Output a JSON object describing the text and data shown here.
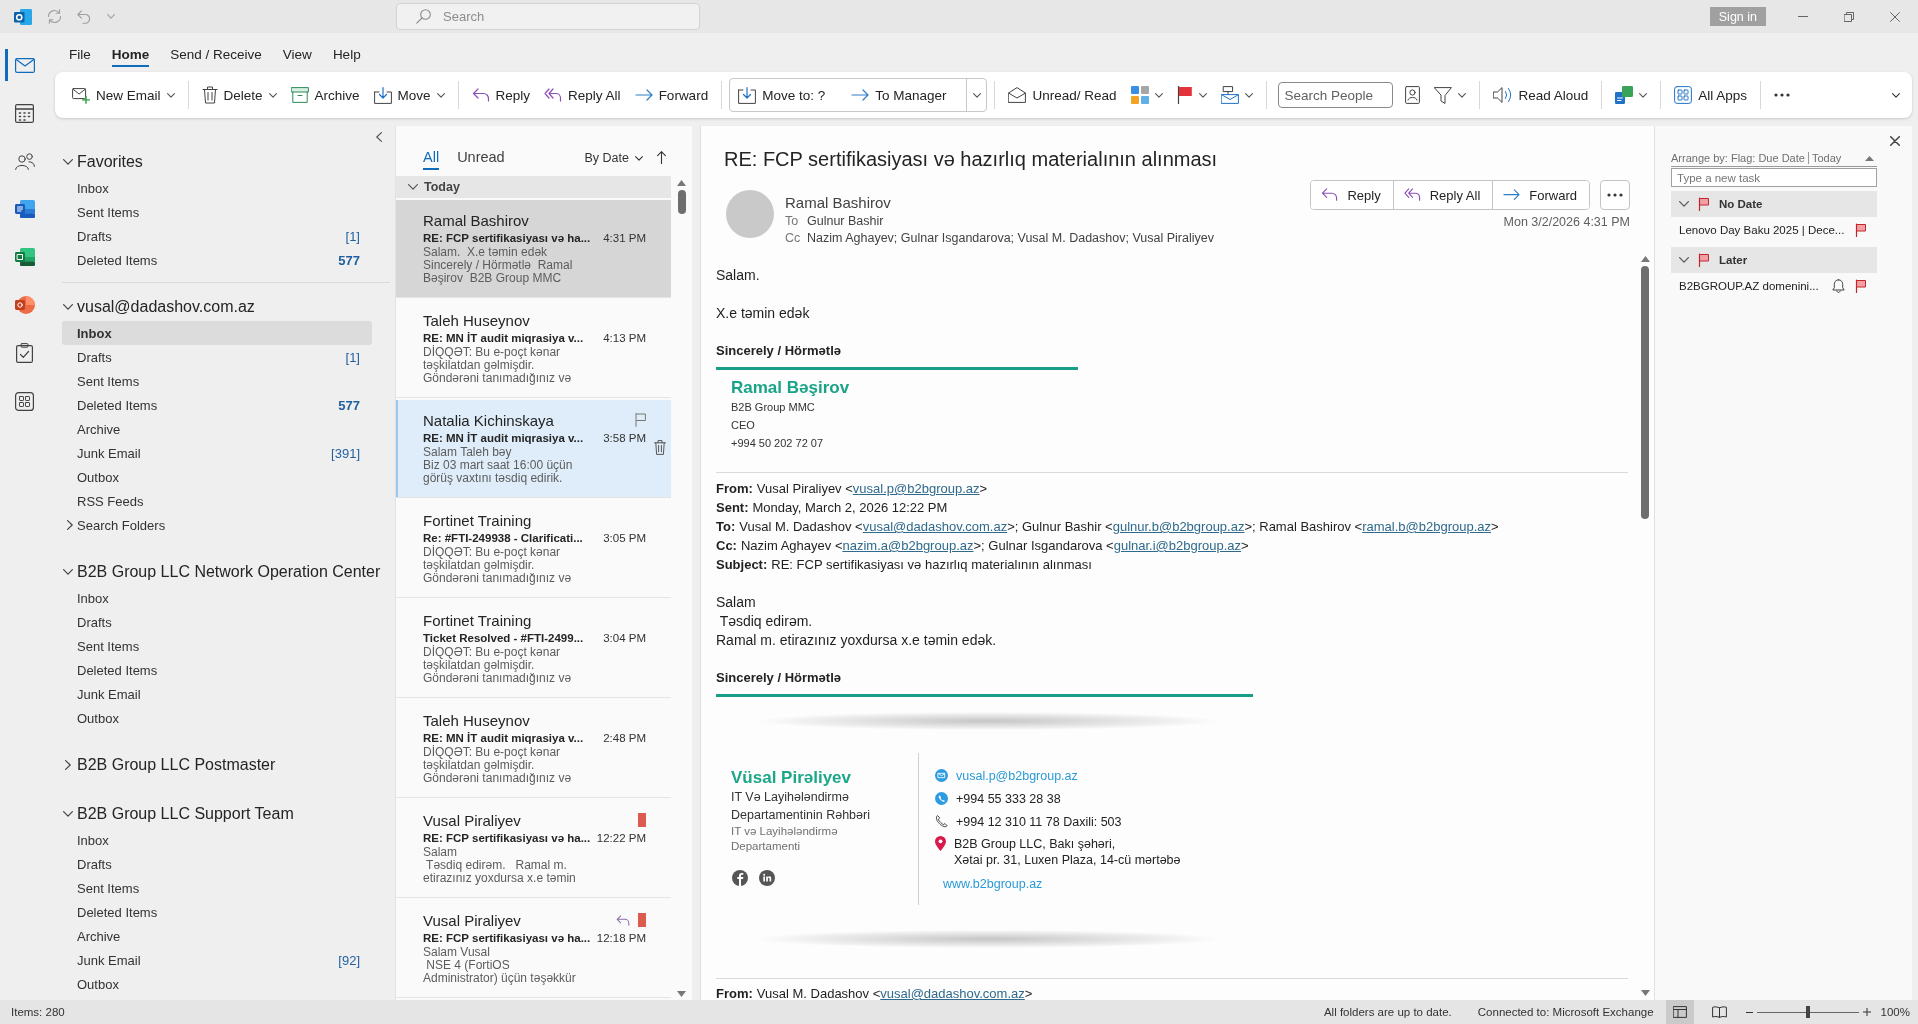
{
  "title_bar": {
    "search_placeholder": "Search",
    "sign_in": "Sign in"
  },
  "app_rail": [
    {
      "selected": true
    },
    {
      "selected": false
    },
    {
      "selected": false
    },
    {
      "selected": false
    },
    {
      "selected": false
    },
    {
      "selected": false
    },
    {
      "selected": false
    },
    {
      "selected": false
    }
  ],
  "menu_tabs": [
    {
      "label": "File",
      "selected": false
    },
    {
      "label": "Home",
      "selected": true
    },
    {
      "label": "Send / Receive",
      "selected": false
    },
    {
      "label": "View",
      "selected": false
    },
    {
      "label": "Help",
      "selected": false
    }
  ],
  "ribbon": [
    {
      "kind": "button",
      "label": "New Email",
      "dropdown": true
    },
    {
      "kind": "separator"
    },
    {
      "kind": "button",
      "label": "Delete",
      "dropdown": true
    },
    {
      "kind": "button",
      "label": "Archive",
      "dropdown": false
    },
    {
      "kind": "button",
      "label": "Move",
      "dropdown": true
    },
    {
      "kind": "separator"
    },
    {
      "kind": "button",
      "label": "Reply",
      "dropdown": false
    },
    {
      "kind": "button",
      "label": "Reply All",
      "dropdown": false
    },
    {
      "kind": "button",
      "label": "Forward",
      "dropdown": false
    },
    {
      "kind": "separator"
    },
    {
      "kind": "quick_steps",
      "steps": [
        "Move to: ?",
        "To Manager"
      ]
    },
    {
      "kind": "separator"
    },
    {
      "kind": "button",
      "label": "Unread/ Read",
      "dropdown": false
    },
    {
      "kind": "button",
      "dropdown": true
    },
    {
      "kind": "button",
      "dropdown": true
    },
    {
      "kind": "button",
      "dropdown": true
    },
    {
      "kind": "separator"
    },
    {
      "kind": "search",
      "placeholder": "Search People"
    },
    {
      "kind": "button",
      "dropdown": false
    },
    {
      "kind": "button",
      "dropdown": true
    },
    {
      "kind": "separator"
    },
    {
      "kind": "button",
      "label": "Read Aloud",
      "dropdown": false
    },
    {
      "kind": "separator"
    },
    {
      "kind": "button",
      "dropdown": true
    },
    {
      "kind": "separator"
    },
    {
      "kind": "button",
      "label": "All Apps",
      "dropdown": false
    },
    {
      "kind": "separator"
    },
    {
      "kind": "more"
    }
  ],
  "folder_pane": {
    "groups": [
      {
        "kind": "favorites",
        "name": "Favorites",
        "expanded": true,
        "folders": [
          {
            "name": "Inbox",
            "selected": false
          },
          {
            "name": "Sent Items",
            "selected": false
          },
          {
            "name": "Drafts",
            "count": "[1]",
            "unread": false,
            "selected": false
          },
          {
            "name": "Deleted Items",
            "count": "577",
            "unread": true,
            "selected": false
          }
        ]
      },
      {
        "kind": "account",
        "name": "vusal@dadashov.com.az",
        "expanded": true,
        "folders": [
          {
            "name": "Inbox",
            "selected": true
          },
          {
            "name": "Drafts",
            "count": "[1]",
            "unread": false,
            "selected": false
          },
          {
            "name": "Sent Items",
            "selected": false
          },
          {
            "name": "Deleted Items",
            "count": "577",
            "unread": true,
            "selected": false
          },
          {
            "name": "Archive",
            "selected": false
          },
          {
            "name": "Junk Email",
            "count": "[391]",
            "unread": false,
            "selected": false
          },
          {
            "name": "Outbox",
            "selected": false
          },
          {
            "name": "RSS Feeds",
            "selected": false
          },
          {
            "name": "Search Folders",
            "expanded": false,
            "selected": false
          }
        ]
      },
      {
        "kind": "account",
        "name": "B2B Group LLC Network Operation Center",
        "expanded": true,
        "folders": [
          {
            "name": "Inbox",
            "selected": false
          },
          {
            "name": "Drafts",
            "selected": false
          },
          {
            "name": "Sent Items",
            "selected": false
          },
          {
            "name": "Deleted Items",
            "selected": false
          },
          {
            "name": "Junk Email",
            "selected": false
          },
          {
            "name": "Outbox",
            "selected": false
          }
        ]
      },
      {
        "kind": "account",
        "name": "B2B Group LLC Postmaster",
        "expanded": false
      },
      {
        "kind": "account",
        "name": "B2B Group LLC Support Team",
        "expanded": true,
        "folders": [
          {
            "name": "Inbox",
            "selected": false
          },
          {
            "name": "Drafts",
            "selected": false
          },
          {
            "name": "Sent Items",
            "selected": false
          },
          {
            "name": "Deleted Items",
            "selected": false
          },
          {
            "name": "Archive",
            "selected": false
          },
          {
            "name": "Junk Email",
            "count": "[92]",
            "unread": false,
            "selected": false
          },
          {
            "name": "Outbox",
            "selected": false
          }
        ]
      }
    ]
  },
  "message_list": {
    "filters": [
      {
        "label": "All",
        "selected": true
      },
      {
        "label": "Unread",
        "selected": false
      }
    ],
    "sort": "By Date",
    "group": {
      "label": "Today",
      "expanded": true
    },
    "messages": [
      {
        "sender": "Ramal Bashirov",
        "subject": "RE: FCP sertifikasiyası və ha...",
        "time": "4:31 PM",
        "preview": [
          "Salam.  X.e təmin edək",
          "Sincerely / Hörmətlə  Ramal",
          "Bəşirov  B2B Group MMC"
        ],
        "selected": true,
        "hovered": false,
        "replied": false
      },
      {
        "sender": "Taleh Huseynov",
        "subject": "RE: MN İT audit miqrasiya v...",
        "time": "4:13 PM",
        "preview": [
          "DİQQƏT: Bu e-poçt kənar",
          "təşkilatdan gəlmişdir.",
          "Göndərəni tanımadığınız və"
        ],
        "selected": false,
        "hovered": false,
        "replied": false
      },
      {
        "sender": "Natalia Kichinskaya",
        "subject": "RE: MN İT audit miqrasiya v...",
        "time": "3:58 PM",
        "preview": [
          "Salam Taleh bəy",
          "Biz 03 mart saat 16:00 üçün",
          "görüş vaxtını təsdiq edirik."
        ],
        "selected": false,
        "hovered": true,
        "replied": false
      },
      {
        "sender": "Fortinet Training",
        "subject": "Re: #FTI-249938 - Clarificati...",
        "time": "3:05 PM",
        "preview": [
          "DİQQƏT: Bu e-poçt kənar",
          "təşkilatdan gəlmişdir.",
          "Göndərəni tanımadığınız və"
        ],
        "selected": false,
        "hovered": false,
        "replied": false
      },
      {
        "sender": "Fortinet Training",
        "subject": "Ticket Resolved - #FTI-2499...",
        "time": "3:04 PM",
        "preview": [
          "DİQQƏT: Bu e-poçt kənar",
          "təşkilatdan gəlmişdir.",
          "Göndərəni tanımadığınız və"
        ],
        "selected": false,
        "hovered": false,
        "replied": false
      },
      {
        "sender": "Taleh Huseynov",
        "subject": "RE: MN İT audit miqrasiya v...",
        "time": "2:48 PM",
        "preview": [
          "DİQQƏT: Bu e-poçt kənar",
          "təşkilatdan gəlmişdir.",
          "Göndərəni tanımadığınız və"
        ],
        "selected": false,
        "hovered": false,
        "replied": false
      },
      {
        "sender": "Vusal Piraliyev",
        "subject": "RE: FCP sertifikasiyası və ha...",
        "time": "12:22 PM",
        "preview": [
          "Salam",
          " Təsdiq edirəm.   Ramal m.",
          "etirazınız yoxdursa x.e təmin"
        ],
        "selected": false,
        "hovered": false,
        "replied": false,
        "color": "#dc5a4e"
      },
      {
        "sender": "Vusal Piraliyev",
        "subject": "RE: FCP sertifikasiyası və ha...",
        "time": "12:18 PM",
        "preview": [
          "Salam Vusal",
          " NSE 4 (FortiOS",
          "Administrator) üçün təşəkkür"
        ],
        "selected": false,
        "hovered": false,
        "replied": true,
        "color": "#dc5a4e"
      }
    ]
  },
  "reading_pane": {
    "subject": "RE: FCP sertifikasiyası və hazırlıq materialının alınması",
    "sender": "Ramal Bashirov",
    "recipients": [
      {
        "label": "To",
        "names": "Gulnur Bashir"
      },
      {
        "label": "Cc",
        "names": "Nazim Aghayev; Gulnar Isgandarova; Vusal M. Dadashov; Vusal Piraliyev"
      }
    ],
    "actions": [
      "Reply",
      "Reply All",
      "Forward"
    ],
    "date": "Mon 3/2/2026 4:31 PM",
    "body": {
      "paragraphs": [
        "Salam.",
        "X.e təmin edək"
      ],
      "closing": "Sincerely / Hörmətlə",
      "signature": {
        "name": "Ramal Bəşirov",
        "lines": [
          "B2B Group MMC",
          "CEO",
          "+994 50 202 72 07"
        ]
      },
      "quoted": [
        {
          "headers": [
            {
              "label": "From:",
              "parts": [
                {
                  "text": "Vusal Piraliyev <"
                },
                {
                  "link": "vusal.p@b2bgroup.az"
                },
                {
                  "text": ">"
                }
              ]
            },
            {
              "label": "Sent:",
              "parts": [
                {
                  "text": "Monday, March 2, 2026 12:22 PM"
                }
              ]
            },
            {
              "label": "To:",
              "parts": [
                {
                  "text": "Vusal M. Dadashov <"
                },
                {
                  "link": "vusal@dadashov.com.az"
                },
                {
                  "text": ">; Gulnur Bashir <"
                },
                {
                  "link": "gulnur.b@b2bgroup.az"
                },
                {
                  "text": ">; Ramal Bashirov <"
                },
                {
                  "link": "ramal.b@b2bgroup.az"
                },
                {
                  "text": ">"
                }
              ]
            },
            {
              "label": "Cc:",
              "parts": [
                {
                  "text": "Nazim Aghayev <"
                },
                {
                  "link": "nazim.a@b2bgroup.az"
                },
                {
                  "text": ">; Gulnar Isgandarova <"
                },
                {
                  "link": "gulnar.i@b2bgroup.az"
                },
                {
                  "text": ">"
                }
              ]
            },
            {
              "label": "Subject:",
              "parts": [
                {
                  "text": "RE: FCP sertifikasiyası və hazırlıq materialının alınması"
                }
              ]
            }
          ],
          "lines": [
            "Salam",
            " Təsdiq edirəm.",
            "Ramal m. etirazınız yoxdursa x.e təmin edək."
          ],
          "closing": "Sincerely / Hörmətlə",
          "signature_card": {
            "name": "Vüsal Pirəliyev",
            "title": [
              "IT Və Layihələndirmə",
              "Departamentinin Rəhbəri"
            ],
            "department": [
              "IT və Layihələndirmə",
              "Departamenti"
            ],
            "contacts": [
              {
                "kind": "email",
                "lines": [
                  "vusal.p@b2bgroup.az"
                ]
              },
              {
                "kind": "mobile",
                "lines": [
                  "+994 55 333 28 38"
                ]
              },
              {
                "kind": "phone",
                "lines": [
                  "+994 12 310 11 78 Daxili: 503"
                ]
              },
              {
                "kind": "address",
                "lines": [
                  "B2B Group LLC, Bakı şəhəri,",
                  "Xətai pr. 31, Luxen Plaza, 14-cü mərtəbə"
                ]
              },
              {
                "kind": "website",
                "lines": [
                  "www.b2bgroup.az"
                ]
              }
            ]
          }
        },
        {
          "headers": [
            {
              "label": "From:",
              "parts": [
                {
                  "text": "Vusal M. Dadashov <"
                },
                {
                  "link": "vusal@dadashov.com.az"
                },
                {
                  "text": ">"
                }
              ]
            }
          ]
        }
      ]
    }
  },
  "to_do_bar": {
    "arrange_by": "Arrange by: Flag: Due Date",
    "sort": "Today",
    "new_task_placeholder": "Type a new task",
    "groups": [
      {
        "label": "No Date",
        "expanded": true,
        "tasks": [
          {
            "title": "Lenovo Day Baku 2025 | Dece...",
            "reminder": false
          }
        ]
      },
      {
        "label": "Later",
        "expanded": true,
        "tasks": [
          {
            "title": "B2BGROUP.AZ domenini...",
            "reminder": true
          }
        ]
      }
    ]
  },
  "status_bar": {
    "items": "Items: 280",
    "sync": "All folders are up to date.",
    "connection": "Connected to: Microsoft Exchange",
    "views": [
      {
        "selected": true
      },
      {
        "selected": false
      }
    ],
    "zoom": {
      "level": 0.5,
      "reading": "100%"
    }
  }
}
